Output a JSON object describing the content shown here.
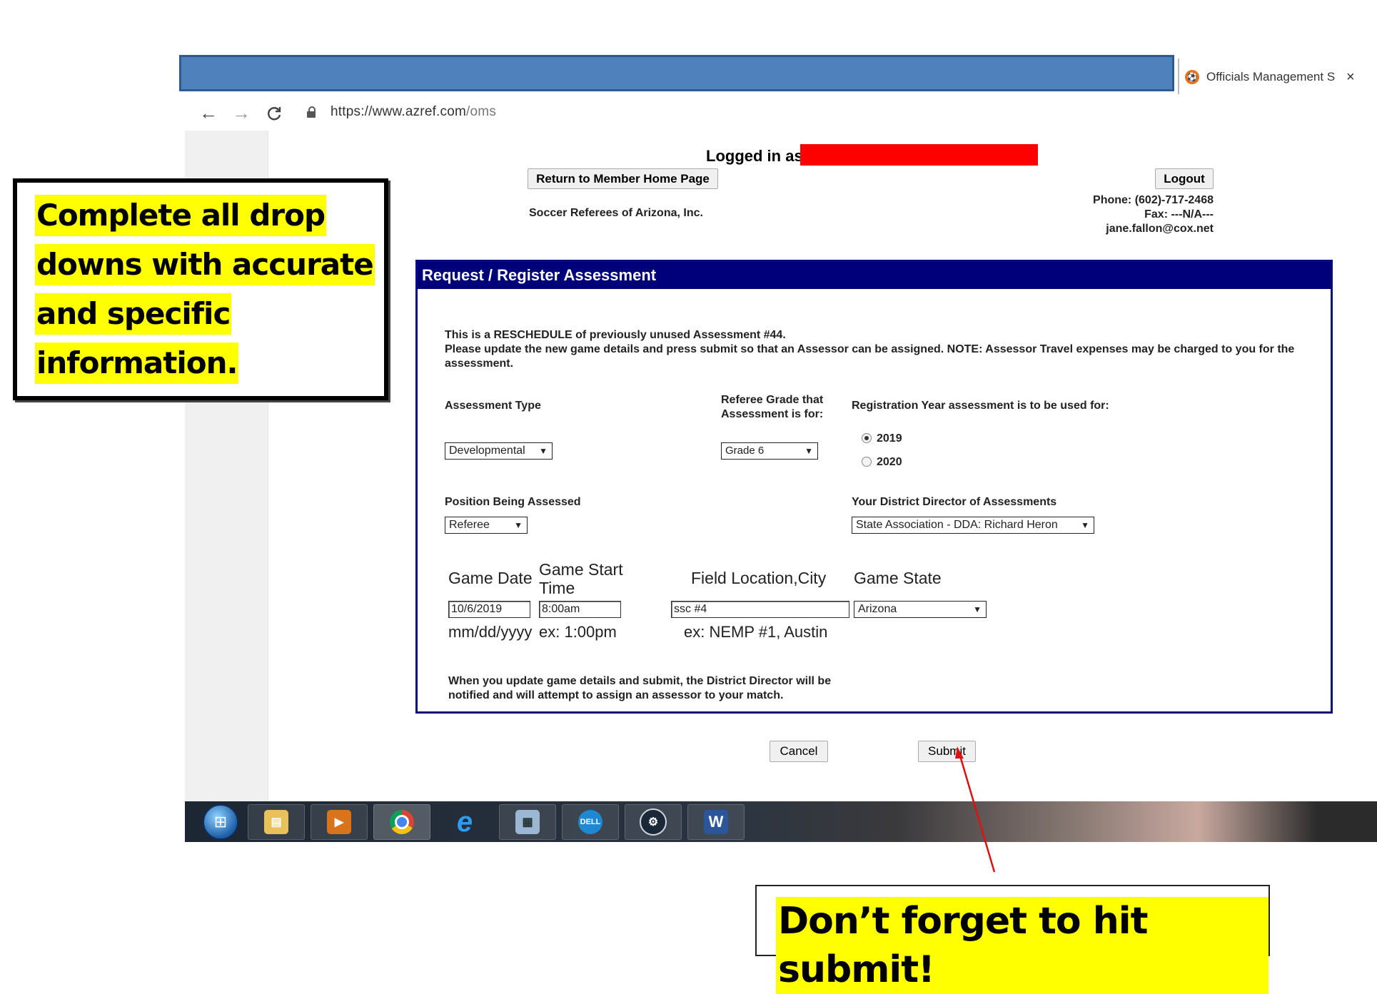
{
  "browser": {
    "tab_title": "Officials Management S",
    "tab_close": "×",
    "url_host": "https://www.azref.com",
    "url_path": "/oms",
    "nav_back": "←",
    "nav_forward": "→",
    "nav_reload": "C"
  },
  "header": {
    "logged_in_label": "Logged in as",
    "home_button": "Return to Member Home Page",
    "logout_button": "Logout",
    "org_name": "Soccer Referees of Arizona, Inc.",
    "phone": "Phone: (602)-717-2468",
    "fax": "Fax: ---N/A---",
    "email": "jane.fallon@cox.net"
  },
  "form": {
    "title": "Request / Register Assessment",
    "intro_line1": "This is a RESCHEDULE of previously unused Assessment #44.",
    "intro_line2": "Please update the new game details and press submit so that an Assessor can be assigned.  NOTE: Assessor Travel expenses may be charged to you for the assessment.",
    "assessment_type_label": "Assessment Type",
    "assessment_type_value": "Developmental",
    "grade_label_line1": "Referee Grade that",
    "grade_label_line2": "Assessment is for:",
    "grade_value": "Grade 6",
    "reg_year_label": "Registration Year assessment is to be used for:",
    "reg_year_options": [
      "2019",
      "2020"
    ],
    "reg_year_selected": "2019",
    "position_label": "Position Being Assessed",
    "position_value": "Referee",
    "director_label": "Your District Director of Assessments",
    "director_value": "State Association - DDA: Richard Heron",
    "game_date_label": "Game Date",
    "game_start_label_line1": "Game Start",
    "game_start_label_line2": "Time",
    "field_location_label": "Field Location,City",
    "game_state_label": "Game State",
    "game_date_value": "10/6/2019",
    "game_start_value": "8:00am",
    "field_location_value": "ssc #4",
    "game_state_value": "Arizona",
    "game_date_hint": "mm/dd/yyyy",
    "game_start_hint": "ex: 1:00pm",
    "field_location_hint": "ex: NEMP #1, Austin",
    "footer_note_line1": "When you update game details and submit, the District Director will be",
    "footer_note_line2": "notified and will attempt to assign an assessor to your match.",
    "cancel_button": "Cancel",
    "submit_button": "Submit"
  },
  "callouts": {
    "left_lines": [
      "Complete all drop",
      "downs with accurate",
      "and specific",
      "information."
    ],
    "bottom": "Don’t forget to hit submit!"
  },
  "colors": {
    "panel_header": "#00007a",
    "redaction": "#ff0000",
    "highlight": "#ffff00",
    "window_bar": "#4f81bd",
    "arrow": "#e01010"
  },
  "taskbar": {
    "items": [
      "start-orb",
      "file-explorer",
      "media-player",
      "chrome",
      "internet-explorer",
      "calculator",
      "dell",
      "steam",
      "word"
    ]
  }
}
